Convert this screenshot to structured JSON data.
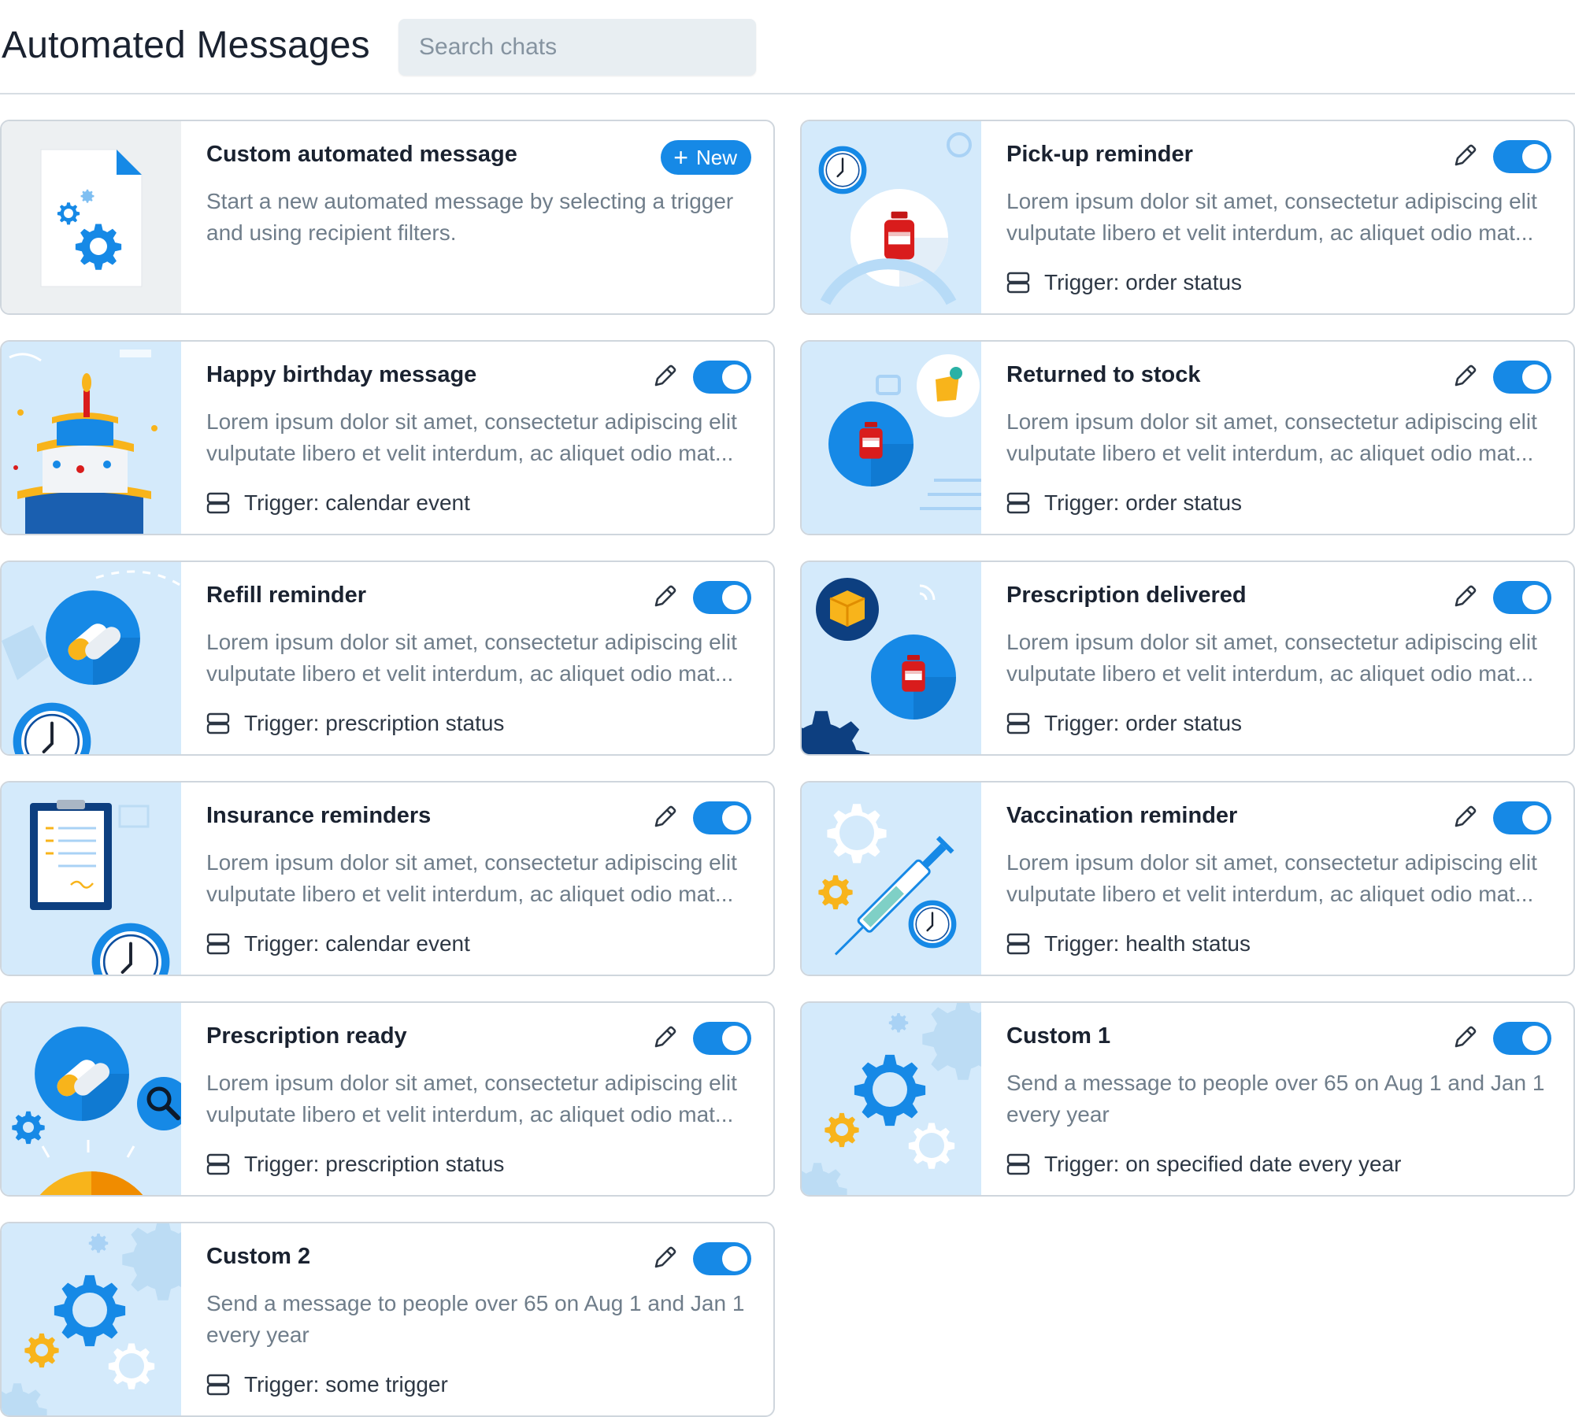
{
  "header": {
    "title": "Automated Messages",
    "search_placeholder": "Search chats"
  },
  "custom_card": {
    "title": "Custom automated message",
    "new_label": "New",
    "description": "Start a new automated message by selecting a trigger and using recipient filters."
  },
  "cards": [
    {
      "title": "Pick-up reminder",
      "description": "Lorem ipsum dolor sit amet, consectetur adipiscing elit vulputate libero et velit interdum, ac aliquet odio mat...",
      "trigger": "Trigger: order status",
      "enabled": true
    },
    {
      "title": "Happy birthday message",
      "description": "Lorem ipsum dolor sit amet, consectetur adipiscing elit vulputate libero et velit interdum, ac aliquet odio mat...",
      "trigger": "Trigger: calendar event",
      "enabled": true
    },
    {
      "title": "Returned to stock",
      "description": "Lorem ipsum dolor sit amet, consectetur adipiscing elit vulputate libero et velit interdum, ac aliquet odio mat...",
      "trigger": "Trigger: order status",
      "enabled": true
    },
    {
      "title": "Refill reminder",
      "description": "Lorem ipsum dolor sit amet, consectetur adipiscing elit vulputate libero et velit interdum, ac aliquet odio mat...",
      "trigger": "Trigger: prescription status",
      "enabled": true
    },
    {
      "title": "Prescription delivered",
      "description": "Lorem ipsum dolor sit amet, consectetur adipiscing elit vulputate libero et velit interdum, ac aliquet odio mat...",
      "trigger": "Trigger: order status",
      "enabled": true
    },
    {
      "title": "Insurance reminders",
      "description": "Lorem ipsum dolor sit amet, consectetur adipiscing elit vulputate libero et velit interdum, ac aliquet odio mat...",
      "trigger": "Trigger: calendar event",
      "enabled": true
    },
    {
      "title": "Vaccination reminder",
      "description": "Lorem ipsum dolor sit amet, consectetur adipiscing elit vulputate libero et velit interdum, ac aliquet odio mat...",
      "trigger": "Trigger: health status",
      "enabled": true
    },
    {
      "title": "Prescription ready",
      "description": "Lorem ipsum dolor sit amet, consectetur adipiscing elit vulputate libero et velit interdum, ac aliquet odio mat...",
      "trigger": "Trigger: prescription status",
      "enabled": true
    },
    {
      "title": "Custom 1",
      "description": "Send a message to people over 65 on Aug 1 and Jan 1 every year",
      "trigger": "Trigger: on specified date every year",
      "enabled": true
    },
    {
      "title": "Custom 2",
      "description": "Send a message to people over 65 on Aug 1 and Jan 1 every year",
      "trigger": "Trigger: some trigger",
      "enabled": true
    }
  ],
  "colors": {
    "accent": "#1689e6",
    "thumb_bg": "#d4eafb",
    "muted_text": "#6f7d8a"
  },
  "icons": [
    "document-gears-icon",
    "plus-icon",
    "pencil-icon",
    "toggle-switch",
    "trigger-server-icon",
    "clock-icon",
    "medicine-bottle-icon",
    "birthday-cake-icon",
    "pills-icon",
    "box-icon",
    "clipboard-icon",
    "syringe-icon",
    "gear-icon",
    "magnifier-icon"
  ]
}
